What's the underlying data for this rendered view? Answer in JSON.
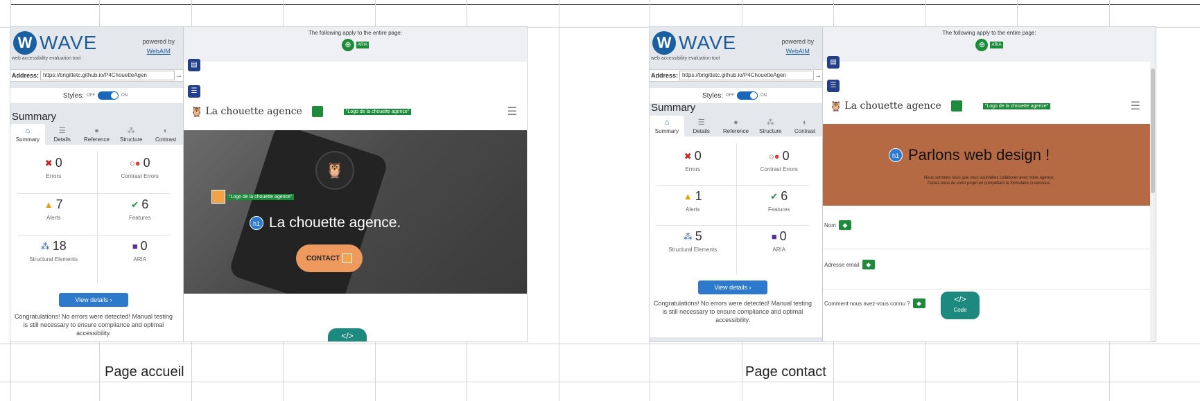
{
  "captions": [
    "Page accueil",
    "Page contact"
  ],
  "colors": {
    "wave_blue": "#1a5fa0",
    "feature_green": "#1d8a3c",
    "structure_navy": "#233f8a",
    "accent_orange": "#ee9a5f",
    "contact_hero": "#b56a43"
  },
  "wave": {
    "logo": "WAVE",
    "tagline": "web accessibility evaluation tool",
    "powered_by": "powered by",
    "webaim": "WebAIM",
    "address_label": "Address:",
    "address_url": "https://brigittetc.github.io/P4ChouetteAgen",
    "styles_label": "Styles:",
    "styles_off": "OFF",
    "styles_on": "ON",
    "summary_title": "Summary",
    "tabs": [
      "Summary",
      "Details",
      "Reference",
      "Structure",
      "Contrast"
    ],
    "view_details": "View details ›",
    "congrats": "Congratulations! No errors were detected! Manual testing is still necessary to ensure compliance and optimal accessibility."
  },
  "site": {
    "applies": "The following apply to the entire page:",
    "aria_badge": "ARIA",
    "brand": "La chouette agence",
    "logo_alt": "\"Logo de la chouette agence\"",
    "h1_badge": "h1",
    "code_badge": "</>",
    "code_label": "Code"
  },
  "page1": {
    "stats": {
      "errors": {
        "value": "0",
        "label": "Errors"
      },
      "contrast": {
        "value": "0",
        "label": "Contrast Errors"
      },
      "alerts": {
        "value": "7",
        "label": "Alerts"
      },
      "features": {
        "value": "6",
        "label": "Features"
      },
      "structural": {
        "value": "18",
        "label": "Structural Elements"
      },
      "aria": {
        "value": "0",
        "label": "ARIA"
      }
    },
    "hero_title": "La chouette agence.",
    "contact_label": "CONTACT"
  },
  "page2": {
    "stats": {
      "errors": {
        "value": "0",
        "label": "Errors"
      },
      "contrast": {
        "value": "0",
        "label": "Contrast Errors"
      },
      "alerts": {
        "value": "1",
        "label": "Alerts"
      },
      "features": {
        "value": "6",
        "label": "Features"
      },
      "structural": {
        "value": "5",
        "label": "Structural Elements"
      },
      "aria": {
        "value": "0",
        "label": "ARIA"
      }
    },
    "hero_title": "Parlons web design !",
    "hero_sub1": "Nous sommes ravis que vous souhaitiez collaborer avec notre agence.",
    "hero_sub2": "Parlez-nous de votre projet en complétant le formulaire ci-dessous.",
    "fields": [
      "Nom",
      "Adresse email",
      "Comment nous avez-vous connu ?"
    ]
  }
}
